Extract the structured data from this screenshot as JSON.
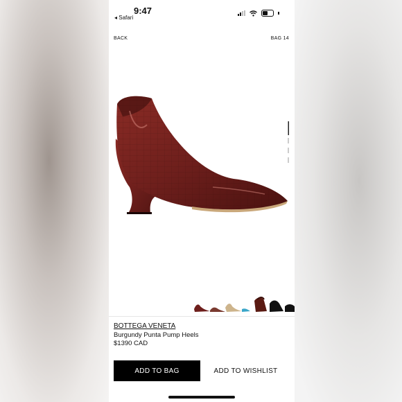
{
  "status": {
    "time": "9:47",
    "back_app": "◂ Safari"
  },
  "nav": {
    "back_label": "BACK",
    "bag_label": "BAG 14"
  },
  "product": {
    "brand": "BOTTEGA VENETA",
    "name": "Burgundy Punta Pump Heels",
    "price": "$1390 CAD",
    "color": "#6e1f1c"
  },
  "actions": {
    "add_to_bag": "ADD TO BAG",
    "add_to_wishlist": "ADD TO WISHLIST"
  },
  "icons": [
    "signal-icon",
    "wifi-icon",
    "battery-icon"
  ]
}
